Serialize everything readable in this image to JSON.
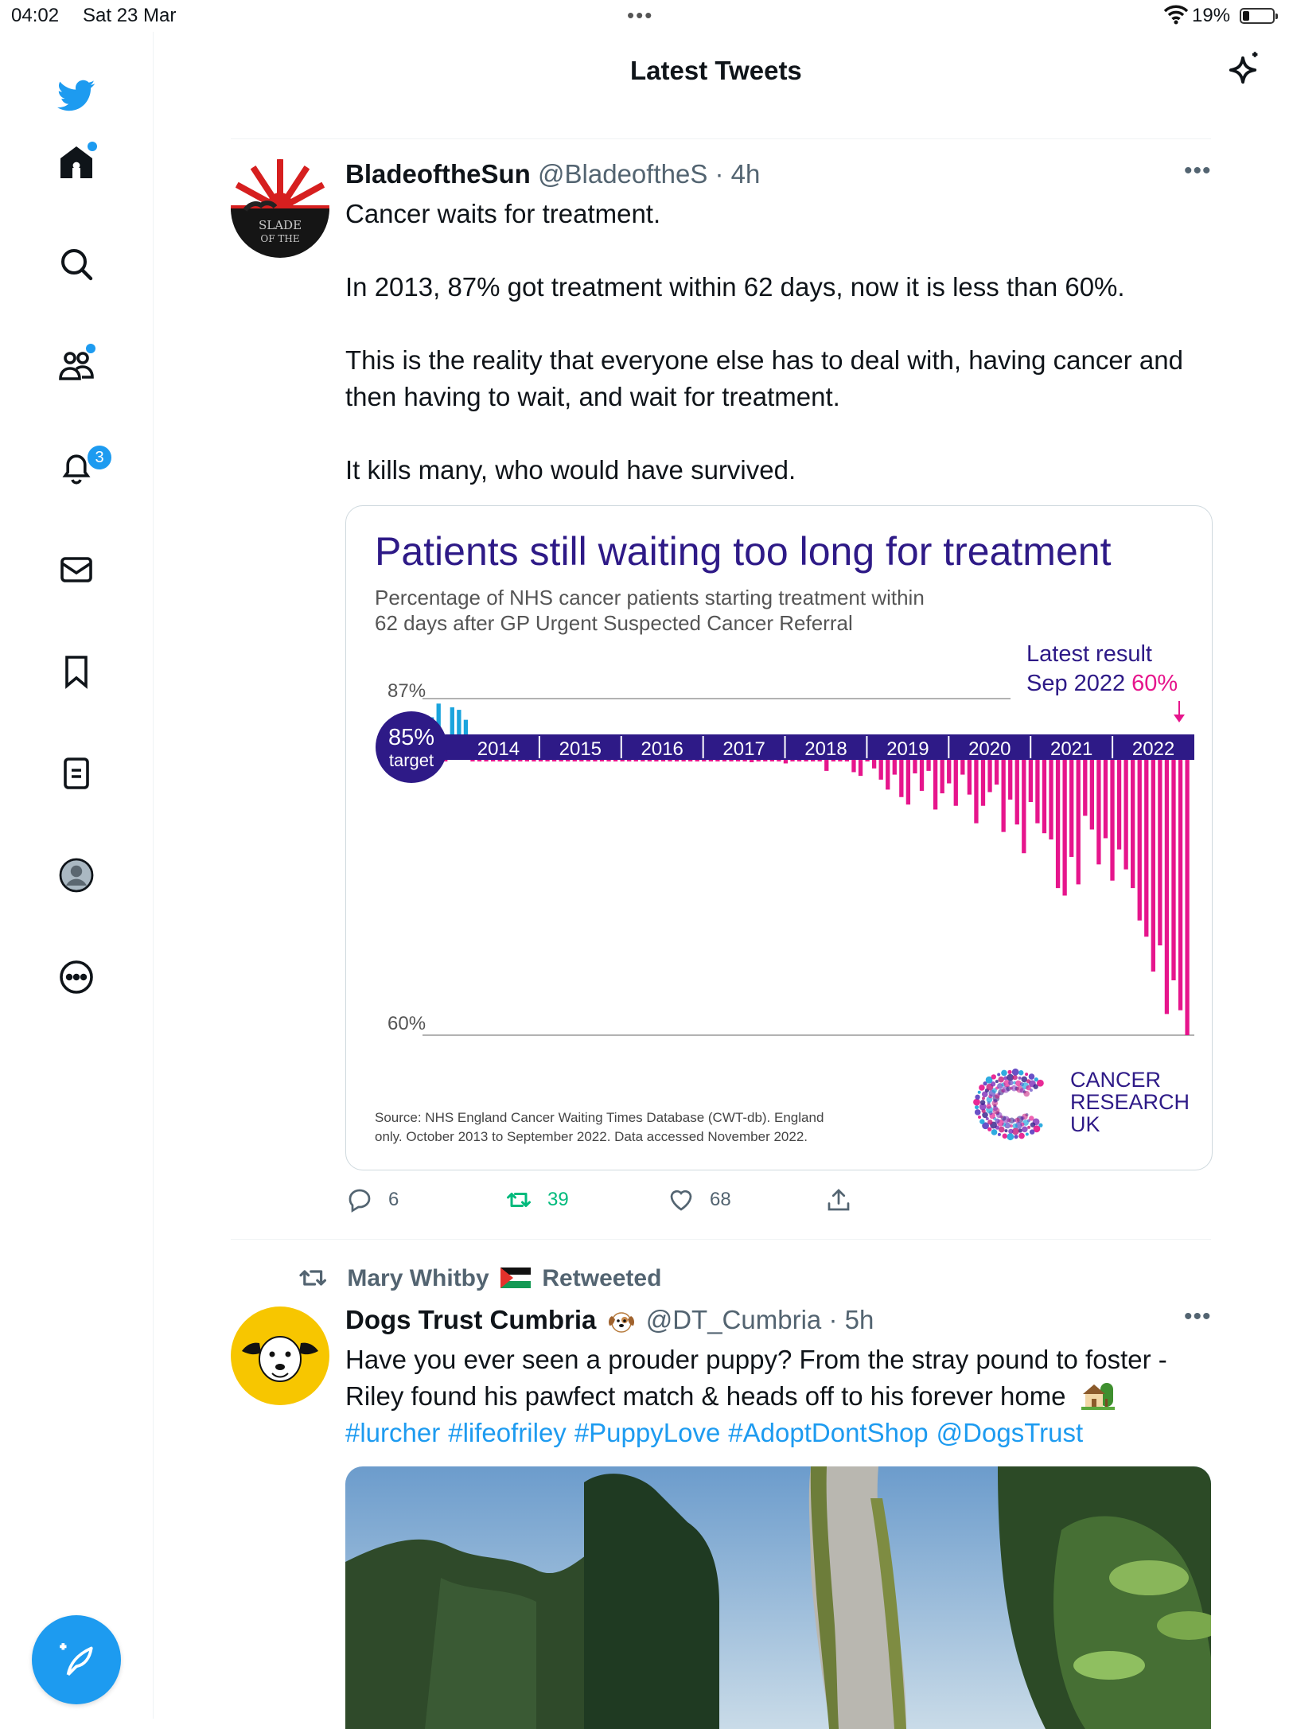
{
  "status_bar": {
    "time": "04:02",
    "date": "Sat 23 Mar",
    "battery": "19%"
  },
  "header": {
    "title": "Latest Tweets"
  },
  "sidebar": {
    "notifications_count": "3"
  },
  "tweet1": {
    "name": "BladeoftheSun",
    "handle": "@BladeoftheS",
    "time": "· 4h",
    "lines": [
      "Cancer waits for treatment.",
      "In 2013, 87% got treatment within 62 days, now it is less than 60%.",
      "This is the reality that everyone else has to deal with, having cancer and then having to wait, and wait for treatment.",
      "It kills many, who would have survived."
    ],
    "replies": "6",
    "retweets": "39",
    "likes": "68"
  },
  "chart_data": {
    "type": "bar",
    "title": "Patients still waiting too long for treatment",
    "subtitle_line1": "Percentage of NHS cancer patients starting treatment within",
    "subtitle_line2": "62 days after GP Urgent Suspected Cancer Referral",
    "latest_label": "Latest result",
    "latest_date": "Sep 2022",
    "latest_value": "60%",
    "top_tick": "87%",
    "bottom_tick": "60%",
    "target_value": "85%",
    "target_label": "target",
    "ylim": [
      60,
      87
    ],
    "target": 85,
    "years": [
      "2014",
      "2015",
      "2016",
      "2017",
      "2018",
      "2019",
      "2020",
      "2021",
      "2022"
    ],
    "x_range": [
      "Oct 2013",
      "Sep 2022"
    ],
    "values": [
      85.5,
      86.6,
      84.8,
      86.3,
      86.1,
      85.3,
      84.4,
      84.9,
      84.1,
      84.6,
      83.8,
      83.4,
      83.9,
      84.6,
      84.0,
      83.2,
      84.5,
      83.1,
      84.3,
      82.5,
      82.8,
      83.6,
      83.0,
      82.9,
      84.8,
      83.2,
      82.6,
      83.9,
      83.1,
      84.5,
      82.4,
      83.7,
      82.7,
      83.2,
      84.0,
      82.3,
      82.9,
      82.0,
      83.1,
      83.6,
      82.5,
      83.8,
      82.0,
      82.8,
      82.4,
      83.4,
      82.7,
      81.9,
      82.6,
      83.1,
      82.6,
      82.0,
      81.8,
      82.7,
      82.1,
      82.9,
      83.0,
      82.8,
      81.2,
      83.3,
      82.4,
      82.0,
      81.1,
      80.8,
      82.6,
      81.4,
      80.5,
      79.7,
      80.9,
      79.1,
      78.5,
      81.0,
      79.6,
      81.2,
      78.1,
      79.4,
      80.2,
      78.4,
      80.9,
      79.3,
      77.0,
      78.4,
      79.5,
      80.1,
      76.3,
      78.9,
      76.9,
      74.6,
      78.7,
      77.0,
      76.2,
      75.7,
      71.8,
      71.2,
      74.3,
      72.1,
      77.6,
      76.5,
      73.7,
      75.8,
      72.4,
      74.9,
      73.3,
      71.8,
      69.2,
      67.9,
      65.1,
      67.2,
      61.7,
      64.4,
      62.0,
      60.0
    ],
    "source_line1": "Source: NHS England Cancer Waiting Times Database (CWT-db). England",
    "source_line2": "only. October 2013 to September 2022. Data accessed November 2022.",
    "logo_lines": [
      "CANCER",
      "RESEARCH",
      "UK"
    ]
  },
  "tweet2": {
    "retweeted_by": "Mary Whitby",
    "retweeted_label": "Retweeted",
    "name": "Dogs Trust Cumbria",
    "handle": "@DT_Cumbria",
    "time": "· 5h",
    "line1": "Have you ever seen a prouder puppy? From the stray pound to foster -",
    "line2": "Riley found his pawfect match & heads off to his forever home",
    "hashtags": [
      "#lurcher",
      "#lifeofriley",
      "#PuppyLove",
      "#AdoptDontShop",
      "@DogsTrust"
    ]
  },
  "colors": {
    "accent": "#1d9bf0",
    "retweet_green": "#00ba7c",
    "chart_purple": "#2e1a87",
    "chart_magenta": "#e6158c"
  }
}
